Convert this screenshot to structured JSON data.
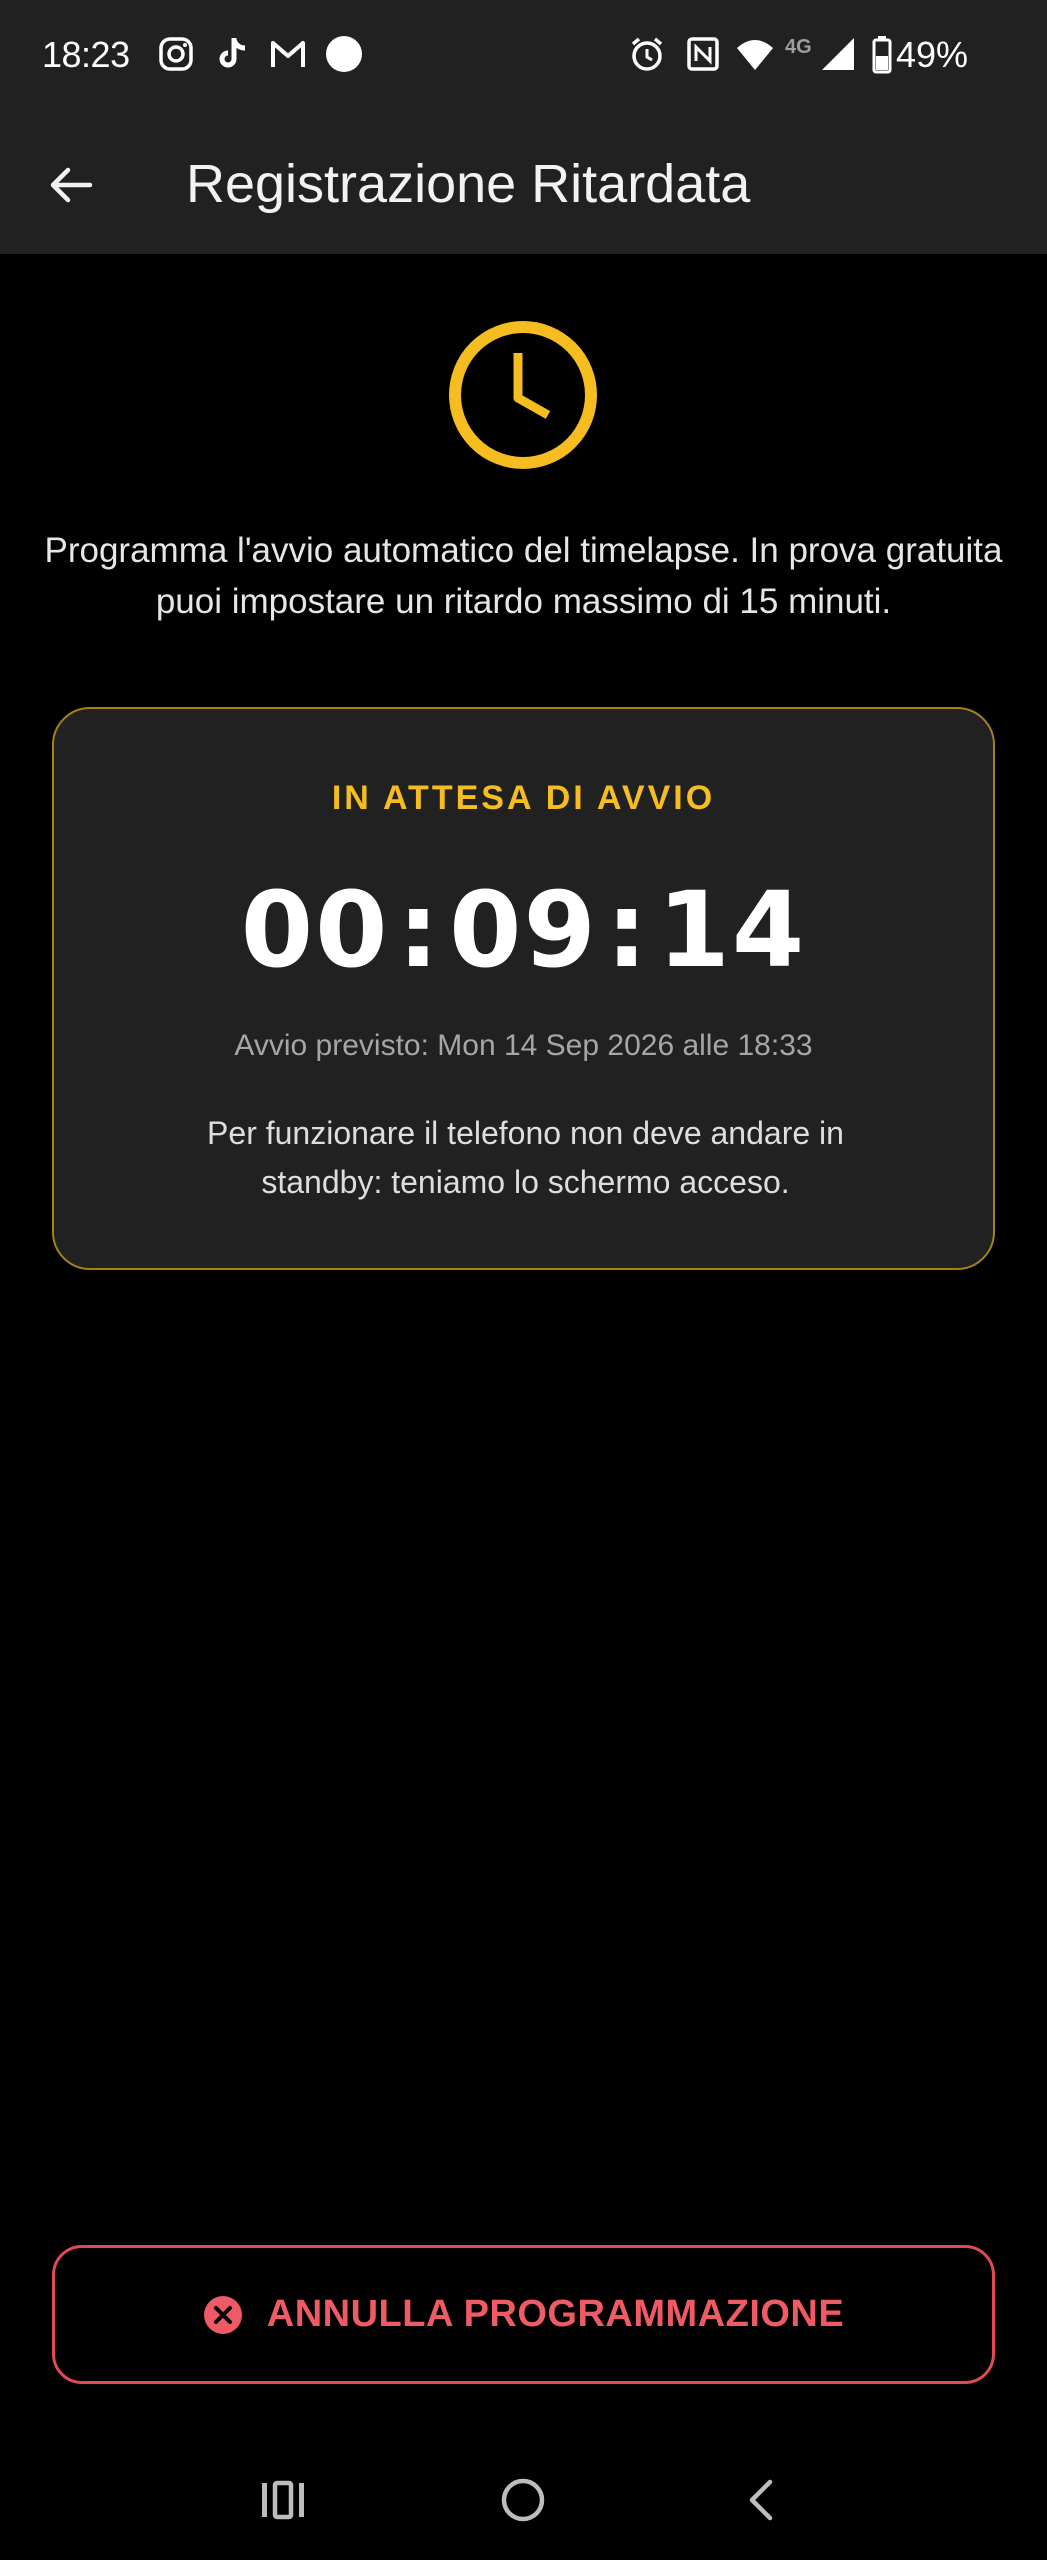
{
  "status_bar": {
    "time": "18:23",
    "network": "4G",
    "battery": "49%",
    "icons": [
      "instagram-icon",
      "tiktok-icon",
      "gmail-icon",
      "dot-icon",
      "alarm-icon",
      "nfc-icon",
      "wifi-icon",
      "signal-icon",
      "battery-icon"
    ]
  },
  "app_bar": {
    "title": "Registrazione Ritardata",
    "back_icon": "arrow-left-icon"
  },
  "intro": {
    "icon": "clock-icon",
    "text": "Programma l'avvio automatico del timelapse. In prova gratuita puoi impostare un ritardo massimo di 15 minuti."
  },
  "card": {
    "status": "IN ATTESA DI AVVIO",
    "countdown": {
      "hours": "00",
      "minutes": "09",
      "seconds": "14",
      "separator": ":"
    },
    "start_info": "Avvio previsto: Mon 14 Sep 2026 alle 18:33",
    "note": "Per funzionare il telefono non deve andare in standby: teniamo lo schermo acceso."
  },
  "cancel_button": {
    "label": "ANNULLA PROGRAMMAZIONE",
    "icon": "close-circle-icon"
  },
  "nav_bar": {
    "items": [
      "recents-icon",
      "home-icon",
      "back-icon"
    ]
  },
  "colors": {
    "accent": "#f5bd1f",
    "danger": "#ef5b64",
    "card_bg": "#212121",
    "background": "#000000"
  }
}
